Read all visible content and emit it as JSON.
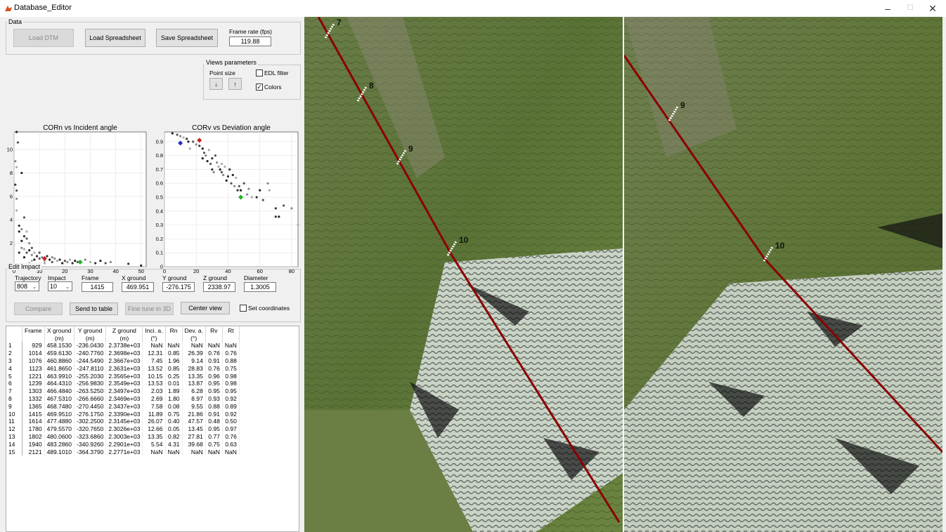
{
  "window": {
    "title": "Database_Editor",
    "min": "–",
    "max": "☐",
    "close": "✕"
  },
  "data_panel": {
    "label": "Data",
    "load_dtm": "Load DTM",
    "load_spreadsheet": "Load Spreadsheet",
    "save_spreadsheet": "Save Spreadsheet",
    "frame_rate_label": "Frame rate (fps)",
    "frame_rate_value": "119.88"
  },
  "views": {
    "label": "Views parameters",
    "point_size": "Point size",
    "down": "↓",
    "up": "↑",
    "edl_filter": "EDL filter",
    "edl_checked": false,
    "colors": "Colors",
    "colors_checked": true
  },
  "chart_data": [
    {
      "type": "scatter",
      "title": "CORn vs Incident angle",
      "xlim": [
        0,
        52
      ],
      "ylim": [
        0,
        11.5
      ],
      "xticks": [
        0,
        10,
        20,
        30,
        40,
        50
      ],
      "yticks": [
        0,
        2,
        4,
        6,
        8,
        10
      ],
      "grid": true,
      "points": [
        [
          1,
          11.5
        ],
        [
          1.5,
          10.6
        ],
        [
          0.5,
          9
        ],
        [
          1,
          8.5
        ],
        [
          0.5,
          7
        ],
        [
          3,
          8
        ],
        [
          1,
          6.5
        ],
        [
          1,
          5.8
        ],
        [
          1,
          4.8
        ],
        [
          2,
          3.5
        ],
        [
          2,
          3
        ],
        [
          4,
          4.2
        ],
        [
          3,
          3.2
        ],
        [
          5,
          3
        ],
        [
          4,
          2.6
        ],
        [
          3,
          2.2
        ],
        [
          5,
          2.4
        ],
        [
          6,
          2
        ],
        [
          4,
          1.5
        ],
        [
          2,
          1.2
        ],
        [
          6,
          1.4
        ],
        [
          7,
          1.6
        ],
        [
          7,
          1
        ],
        [
          8,
          1.2
        ],
        [
          9,
          0.9
        ],
        [
          8,
          0.6
        ],
        [
          10,
          0.7
        ],
        [
          11,
          0.8
        ],
        [
          12,
          0.5
        ],
        [
          13,
          0.9
        ],
        [
          14,
          0.6
        ],
        [
          15,
          0.4
        ],
        [
          16,
          0.7
        ],
        [
          17,
          0.5
        ],
        [
          18,
          0.6
        ],
        [
          19,
          0.3
        ],
        [
          20,
          0.5
        ],
        [
          21,
          0.4
        ],
        [
          22,
          0.6
        ],
        [
          23,
          0.3
        ],
        [
          24,
          0.5
        ],
        [
          25,
          0.4
        ],
        [
          28,
          0.6
        ],
        [
          30,
          0.4
        ],
        [
          32,
          0.3
        ],
        [
          34,
          0.5
        ],
        [
          36,
          0.3
        ],
        [
          38,
          0.4
        ],
        [
          6,
          0.3
        ],
        [
          9,
          0.2
        ],
        [
          4,
          0.8
        ],
        [
          5,
          1.2
        ],
        [
          3,
          1.6
        ],
        [
          7,
          0.5
        ],
        [
          45,
          0.25
        ],
        [
          50,
          0.1
        ],
        [
          10,
          1.2
        ],
        [
          15,
          0.8
        ],
        [
          12,
          0.3
        ]
      ],
      "highlights": [
        {
          "point": [
            7,
            0.1
          ],
          "color": "#2030c0"
        },
        {
          "point": [
            12,
            0.7
          ],
          "color": "#d02020"
        },
        {
          "point": [
            26,
            0.4
          ],
          "color": "#20b020"
        }
      ]
    },
    {
      "type": "scatter",
      "title": "CORv vs Deviation angle",
      "xlim": [
        0,
        84
      ],
      "ylim": [
        0,
        0.97
      ],
      "xticks": [
        0,
        20,
        40,
        60,
        80
      ],
      "yticks": [
        0,
        0.1,
        0.2,
        0.3,
        0.4,
        0.5,
        0.6,
        0.7,
        0.8,
        0.9
      ],
      "grid": true,
      "points": [
        [
          5,
          0.96
        ],
        [
          8,
          0.95
        ],
        [
          10,
          0.94
        ],
        [
          12,
          0.93
        ],
        [
          14,
          0.92
        ],
        [
          15,
          0.9
        ],
        [
          18,
          0.9
        ],
        [
          20,
          0.88
        ],
        [
          16,
          0.85
        ],
        [
          22,
          0.87
        ],
        [
          24,
          0.85
        ],
        [
          25,
          0.82
        ],
        [
          26,
          0.8
        ],
        [
          28,
          0.84
        ],
        [
          30,
          0.78
        ],
        [
          27,
          0.76
        ],
        [
          32,
          0.8
        ],
        [
          33,
          0.75
        ],
        [
          34,
          0.72
        ],
        [
          30,
          0.7
        ],
        [
          35,
          0.7
        ],
        [
          36,
          0.68
        ],
        [
          37,
          0.66
        ],
        [
          38,
          0.72
        ],
        [
          40,
          0.65
        ],
        [
          39,
          0.62
        ],
        [
          42,
          0.6
        ],
        [
          44,
          0.58
        ],
        [
          45,
          0.64
        ],
        [
          46,
          0.55
        ],
        [
          48,
          0.55
        ],
        [
          50,
          0.6
        ],
        [
          52,
          0.52
        ],
        [
          55,
          0.5
        ],
        [
          58,
          0.5
        ],
        [
          60,
          0.55
        ],
        [
          62,
          0.48
        ],
        [
          65,
          0.6
        ],
        [
          66,
          0.55
        ],
        [
          70,
          0.42
        ],
        [
          72,
          0.36
        ],
        [
          75,
          0.44
        ],
        [
          80,
          0.42
        ],
        [
          84,
          0.3
        ],
        [
          70,
          0.36
        ],
        [
          24,
          0.78
        ],
        [
          29,
          0.74
        ],
        [
          31,
          0.68
        ],
        [
          36,
          0.74
        ],
        [
          41,
          0.7
        ],
        [
          43,
          0.66
        ],
        [
          47,
          0.58
        ],
        [
          53,
          0.56
        ]
      ],
      "highlights": [
        {
          "point": [
            10,
            0.89
          ],
          "color": "#2030c0"
        },
        {
          "point": [
            22,
            0.91
          ],
          "color": "#d02020"
        },
        {
          "point": [
            48,
            0.5
          ],
          "color": "#20b020"
        }
      ]
    }
  ],
  "edit_impact": {
    "label": "Edit Impact",
    "trajectory_label": "Trajectory",
    "trajectory_value": "808",
    "impact_label": "Impact",
    "impact_value": "10",
    "frame_label": "Frame",
    "frame_value": "1415",
    "xg_label": "X ground",
    "xg_value": "469.951",
    "yg_label": "Y ground",
    "yg_value": "-276.175",
    "zg_label": "Z ground",
    "zg_value": "2338.97",
    "diam_label": "Diameter",
    "diam_value": "1.3005",
    "compare": "Compare",
    "send_to_table": "Send to table",
    "fine_tune": "Fine tune in 3D",
    "center_view": "Center view",
    "set_coordinates": "Set coordinates"
  },
  "table": {
    "headers": [
      [
        "Frame",
        ""
      ],
      [
        "X ground",
        "(m)"
      ],
      [
        "Y ground",
        "(m)"
      ],
      [
        "Z ground",
        "(m)"
      ],
      [
        "Inci. a.",
        "(°)"
      ],
      [
        "Rn",
        ""
      ],
      [
        "Dev. a.",
        "(°)"
      ],
      [
        "Rv",
        ""
      ],
      [
        "Rt",
        ""
      ]
    ],
    "rows": [
      [
        "1",
        "929",
        "458.1530",
        "-236.0430",
        "2.3738e+03",
        "NaN",
        "NaN",
        "NaN",
        "NaN",
        "NaN"
      ],
      [
        "2",
        "1014",
        "459.6130",
        "-240.7760",
        "2.3698e+03",
        "12.31",
        "0.85",
        "26.39",
        "0.76",
        "0.76"
      ],
      [
        "3",
        "1076",
        "460.8860",
        "-244.5490",
        "2.3667e+03",
        "7.45",
        "1.96",
        "9.14",
        "0.91",
        "0.88"
      ],
      [
        "4",
        "1123",
        "461.8650",
        "-247.8110",
        "2.3631e+03",
        "13.52",
        "0.85",
        "28.83",
        "0.76",
        "0.75"
      ],
      [
        "5",
        "1221",
        "463.9910",
        "-255.2030",
        "2.3565e+03",
        "10.15",
        "0.25",
        "13.35",
        "0.96",
        "0.98"
      ],
      [
        "6",
        "1239",
        "464.4310",
        "-256.9830",
        "2.3549e+03",
        "13.53",
        "0.01",
        "13.87",
        "0.95",
        "0.98"
      ],
      [
        "7",
        "1303",
        "466.4840",
        "-263.5250",
        "2.3497e+03",
        "2.03",
        "1.89",
        "6.28",
        "0.95",
        "0.95"
      ],
      [
        "8",
        "1332",
        "467.5310",
        "-266.6660",
        "2.3469e+03",
        "2.69",
        "1.80",
        "8.97",
        "0.93",
        "0.92"
      ],
      [
        "9",
        "1365",
        "468.7480",
        "-270.4450",
        "2.3437e+03",
        "7.58",
        "0.08",
        "9.55",
        "0.88",
        "0.89"
      ],
      [
        "10",
        "1415",
        "469.9510",
        "-276.1750",
        "2.3390e+03",
        "11.89",
        "0.75",
        "21.86",
        "0.91",
        "0.92"
      ],
      [
        "11",
        "1614",
        "477.4880",
        "-302.2500",
        "2.3145e+03",
        "26.07",
        "0.40",
        "47.57",
        "0.48",
        "0.50"
      ],
      [
        "12",
        "1780",
        "479.5570",
        "-320.7650",
        "2.3026e+03",
        "12.66",
        "0.05",
        "13.45",
        "0.95",
        "0.97"
      ],
      [
        "13",
        "1802",
        "480.0600",
        "-323.6860",
        "2.3003e+03",
        "13.35",
        "0.82",
        "27.81",
        "0.77",
        "0.76"
      ],
      [
        "14",
        "1940",
        "483.2860",
        "-340.9260",
        "2.2901e+03",
        "5.54",
        "4.31",
        "39.68",
        "0.75",
        "0.63"
      ],
      [
        "15",
        "2121",
        "489.1010",
        "-364.3790",
        "2.2771e+03",
        "NaN",
        "NaN",
        "NaN",
        "NaN",
        "NaN"
      ]
    ]
  },
  "views3d": {
    "left_labels": [
      "7",
      "8",
      "9",
      "10"
    ],
    "right_labels": [
      "9",
      "10"
    ],
    "colors": {
      "terrain_green": "#5d7a3a",
      "rock": "#c8d2c4",
      "trajectory": "#8b0000"
    }
  }
}
